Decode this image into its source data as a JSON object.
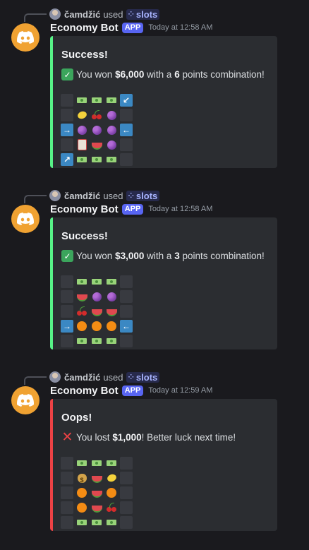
{
  "messages": [
    {
      "reply": {
        "user": "čamdžić",
        "used": "used",
        "command": "slots"
      },
      "bot_name": "Economy Bot",
      "badge": "APP",
      "timestamp": "Today at 12:58 AM",
      "embed": {
        "bar_color": "#57f287",
        "title": "Success!",
        "result_icon": "check-mark-icon",
        "text_prefix": "You won ",
        "amount": "$6,000",
        "text_mid": " with a ",
        "points": "6",
        "text_suffix": " points combination!",
        "grid": [
          [
            "dark",
            "money",
            "money",
            "money",
            "arrow-down-left"
          ],
          [
            "dark",
            "lemon",
            "cherry",
            "grapes",
            "dark"
          ],
          [
            "arrow-right",
            "grapes",
            "grapes",
            "grapes",
            "arrow-left"
          ],
          [
            "dark",
            "slot",
            "watermelon",
            "grapes",
            "dark"
          ],
          [
            "arrow-up-right",
            "money",
            "money",
            "money",
            "dark"
          ]
        ]
      }
    },
    {
      "reply": {
        "user": "čamdžić",
        "used": "used",
        "command": "slots"
      },
      "bot_name": "Economy Bot",
      "badge": "APP",
      "timestamp": "Today at 12:58 AM",
      "embed": {
        "bar_color": "#57f287",
        "title": "Success!",
        "result_icon": "check-mark-icon",
        "text_prefix": "You won ",
        "amount": "$3,000",
        "text_mid": " with a ",
        "points": "3",
        "text_suffix": " points combination!",
        "grid": [
          [
            "dark",
            "money",
            "money",
            "money",
            "dark"
          ],
          [
            "dark",
            "watermelon",
            "grapes",
            "grapes",
            "dark"
          ],
          [
            "dark",
            "cherry",
            "watermelon",
            "watermelon",
            "dark"
          ],
          [
            "arrow-right",
            "orange",
            "orange",
            "orange",
            "arrow-left"
          ],
          [
            "dark",
            "money",
            "money",
            "money",
            "dark"
          ]
        ]
      }
    },
    {
      "reply": {
        "user": "čamdžić",
        "used": "used",
        "command": "slots"
      },
      "bot_name": "Economy Bot",
      "badge": "APP",
      "timestamp": "Today at 12:59 AM",
      "embed": {
        "bar_color": "#ed4245",
        "title": "Oops!",
        "result_icon": "cross-mark-icon",
        "text_prefix": "You lost ",
        "amount": "$1,000",
        "text_mid": "! Better luck next time!",
        "points": "",
        "text_suffix": "",
        "grid": [
          [
            "dark",
            "money",
            "money",
            "money",
            "dark"
          ],
          [
            "dark",
            "moneybag",
            "watermelon",
            "lemon",
            "dark"
          ],
          [
            "dark",
            "orange",
            "watermelon",
            "orange",
            "dark"
          ],
          [
            "dark",
            "orange",
            "watermelon",
            "cherry",
            "dark"
          ],
          [
            "dark",
            "money",
            "money",
            "money",
            "dark"
          ]
        ]
      }
    }
  ]
}
